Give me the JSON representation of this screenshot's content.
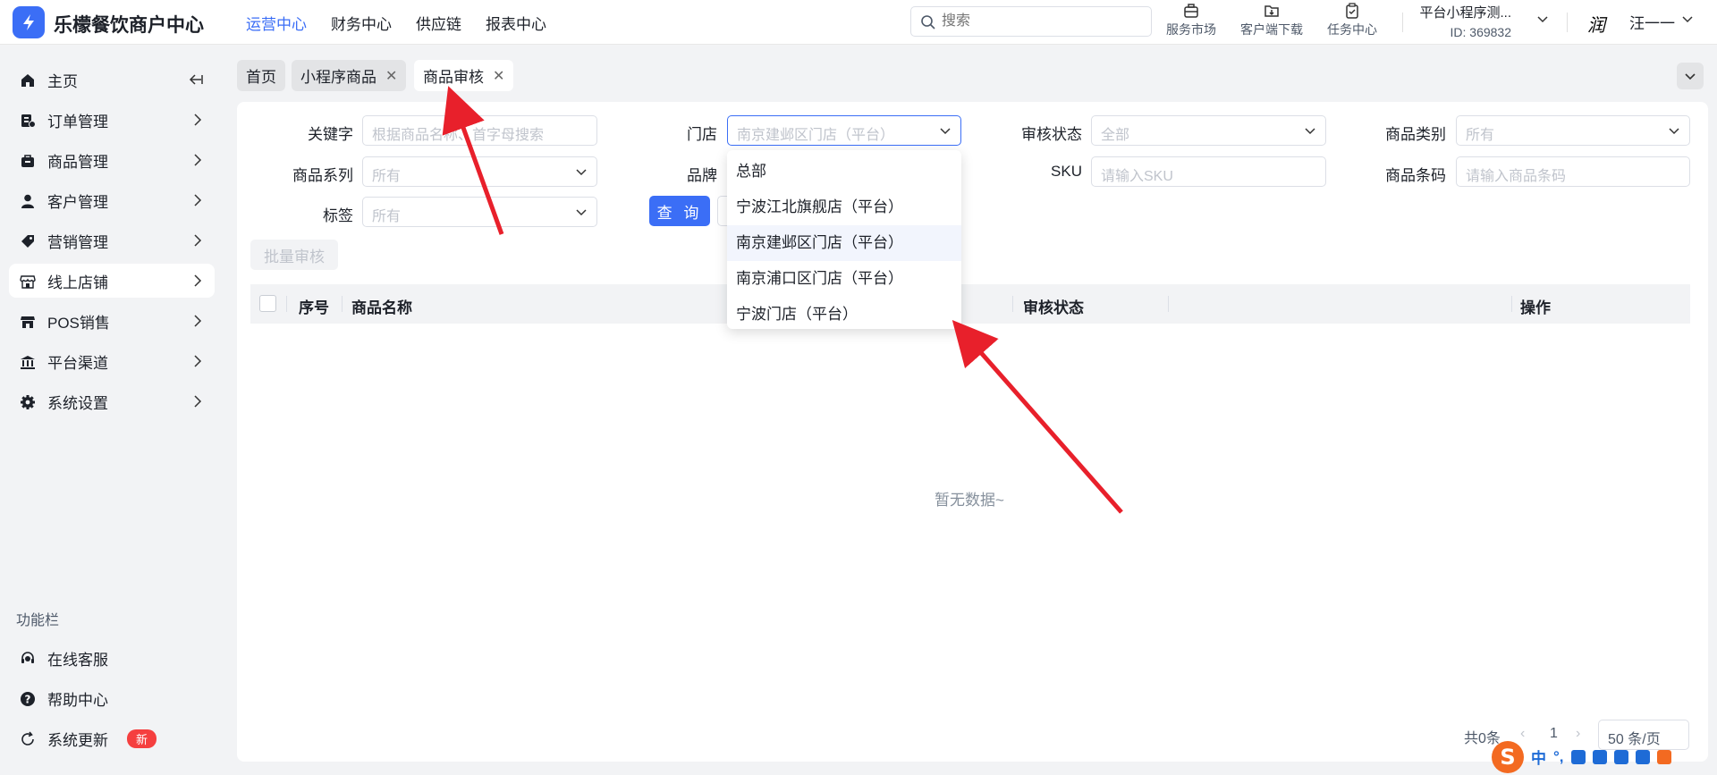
{
  "app": {
    "brand": "乐檬餐饮商户中心"
  },
  "topnav": [
    {
      "label": "运营中心",
      "active": true
    },
    {
      "label": "财务中心",
      "active": false
    },
    {
      "label": "供应链",
      "active": false
    },
    {
      "label": "报表中心",
      "active": false
    }
  ],
  "search": {
    "placeholder": "搜索"
  },
  "tools": [
    {
      "label": "服务市场",
      "icon": "briefcase-icon"
    },
    {
      "label": "客户端下载",
      "icon": "folder-download-icon"
    },
    {
      "label": "任务中心",
      "icon": "clipboard-check-icon"
    }
  ],
  "account": {
    "name": "平台小程序测...",
    "id": "ID: 369832"
  },
  "user": {
    "name": "汪一一"
  },
  "sidebar": {
    "items": [
      {
        "label": "主页",
        "icon": "home-icon"
      },
      {
        "label": "订单管理",
        "icon": "order-icon"
      },
      {
        "label": "商品管理",
        "icon": "goods-icon"
      },
      {
        "label": "客户管理",
        "icon": "user-icon"
      },
      {
        "label": "营销管理",
        "icon": "tag-icon"
      },
      {
        "label": "线上店铺",
        "icon": "store-icon"
      },
      {
        "label": "POS销售",
        "icon": "pos-store-icon"
      },
      {
        "label": "平台渠道",
        "icon": "bank-icon"
      },
      {
        "label": "系统设置",
        "icon": "gear-icon"
      }
    ],
    "func_title": "功能栏",
    "func_items": [
      {
        "label": "在线客服",
        "icon": "headset-icon"
      },
      {
        "label": "帮助中心",
        "icon": "help-icon"
      },
      {
        "label": "系统更新",
        "icon": "refresh-icon",
        "badge": "新"
      }
    ]
  },
  "tabs": [
    {
      "label": "首页",
      "closable": false
    },
    {
      "label": "小程序商品",
      "closable": true
    },
    {
      "label": "商品审核",
      "closable": true,
      "active": true
    }
  ],
  "filters": {
    "keyword_label": "关键字",
    "keyword_placeholder": "根据商品名称、首字母搜索",
    "store_label": "门店",
    "store_value": "南京建邺区门店（平台）",
    "audit_label": "审核状态",
    "audit_value": "全部",
    "category_label": "商品类别",
    "category_value": "所有",
    "series_label": "商品系列",
    "series_value": "所有",
    "brand_label": "品牌",
    "sku_label": "SKU",
    "sku_placeholder": "请输入SKU",
    "barcode_label": "商品条码",
    "barcode_placeholder": "请输入商品条码",
    "tag_label": "标签",
    "tag_value": "所有",
    "query_button": "查 询"
  },
  "batch_button": "批量审核",
  "table": {
    "columns": [
      "序号",
      "商品名称",
      "审核状态",
      "操作"
    ],
    "empty_text": "暂无数据~"
  },
  "store_dropdown": {
    "options": [
      "总部",
      "宁波江北旗舰店（平台）",
      "南京建邺区门店（平台）",
      "南京浦口区门店（平台）",
      "宁波门店（平台）"
    ],
    "selected_index": 2
  },
  "pagination": {
    "total": "共0条",
    "current": "1",
    "page_size": "50 条/页"
  },
  "ime": {
    "lang": "中",
    "punct": "°,"
  },
  "colors": {
    "accent": "#3b6ef6",
    "arrow": "#e8202b",
    "badge": "#f53f3f"
  }
}
